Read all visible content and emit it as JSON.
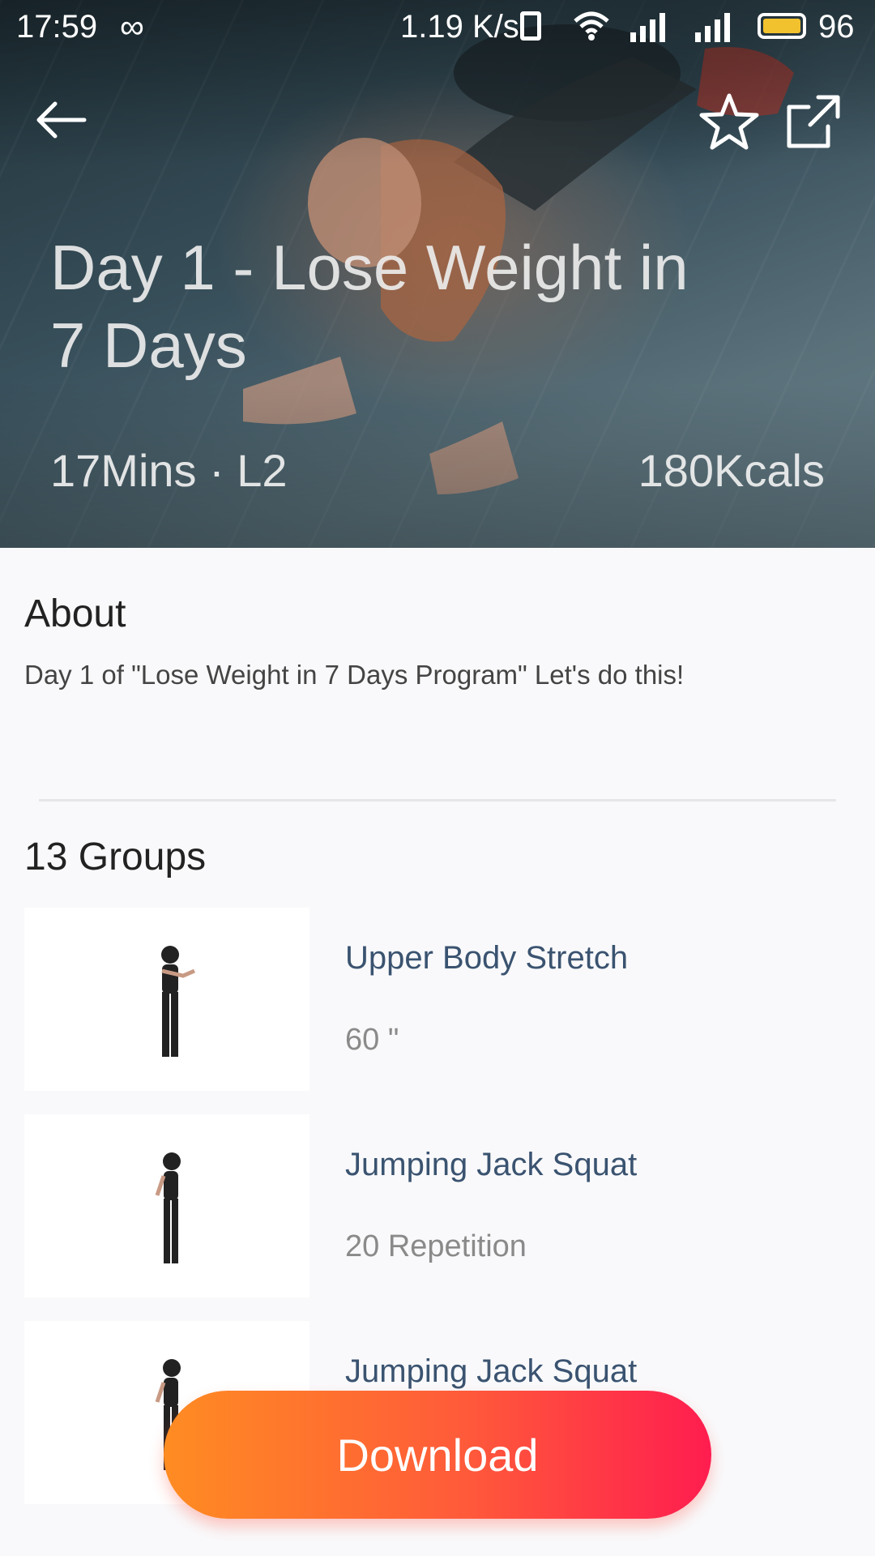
{
  "status_bar": {
    "time": "17:59",
    "loop_icon": "∞",
    "speed": "1.19 K/s",
    "battery": "96",
    "battery_color": "#f2c12e",
    "icons": [
      "vibrate-icon",
      "wifi-icon",
      "signal-4g-icon",
      "signal-3g-icon",
      "battery-icon"
    ]
  },
  "hero": {
    "title": "Day 1 - Lose Weight in 7 Days",
    "meta": "17Mins · L2",
    "kcal": "180Kcals",
    "icons": {
      "back": "back-arrow-icon",
      "favorite": "star-icon",
      "share": "share-icon"
    }
  },
  "about": {
    "heading": "About",
    "text": "Day 1 of \"Lose Weight in 7 Days Program\" Let's do this!"
  },
  "groups": {
    "heading": "13 Groups",
    "items": [
      {
        "name": "Upper Body Stretch",
        "detail": "60 \""
      },
      {
        "name": "Jumping Jack Squat",
        "detail": "20 Repetition"
      },
      {
        "name": "Jumping Jack Squat",
        "detail": ""
      }
    ]
  },
  "download_label": "Download",
  "colors": {
    "accent_start": "#ff8c22",
    "accent_end": "#ff1d4f",
    "exercise_name": "#3a5370"
  }
}
